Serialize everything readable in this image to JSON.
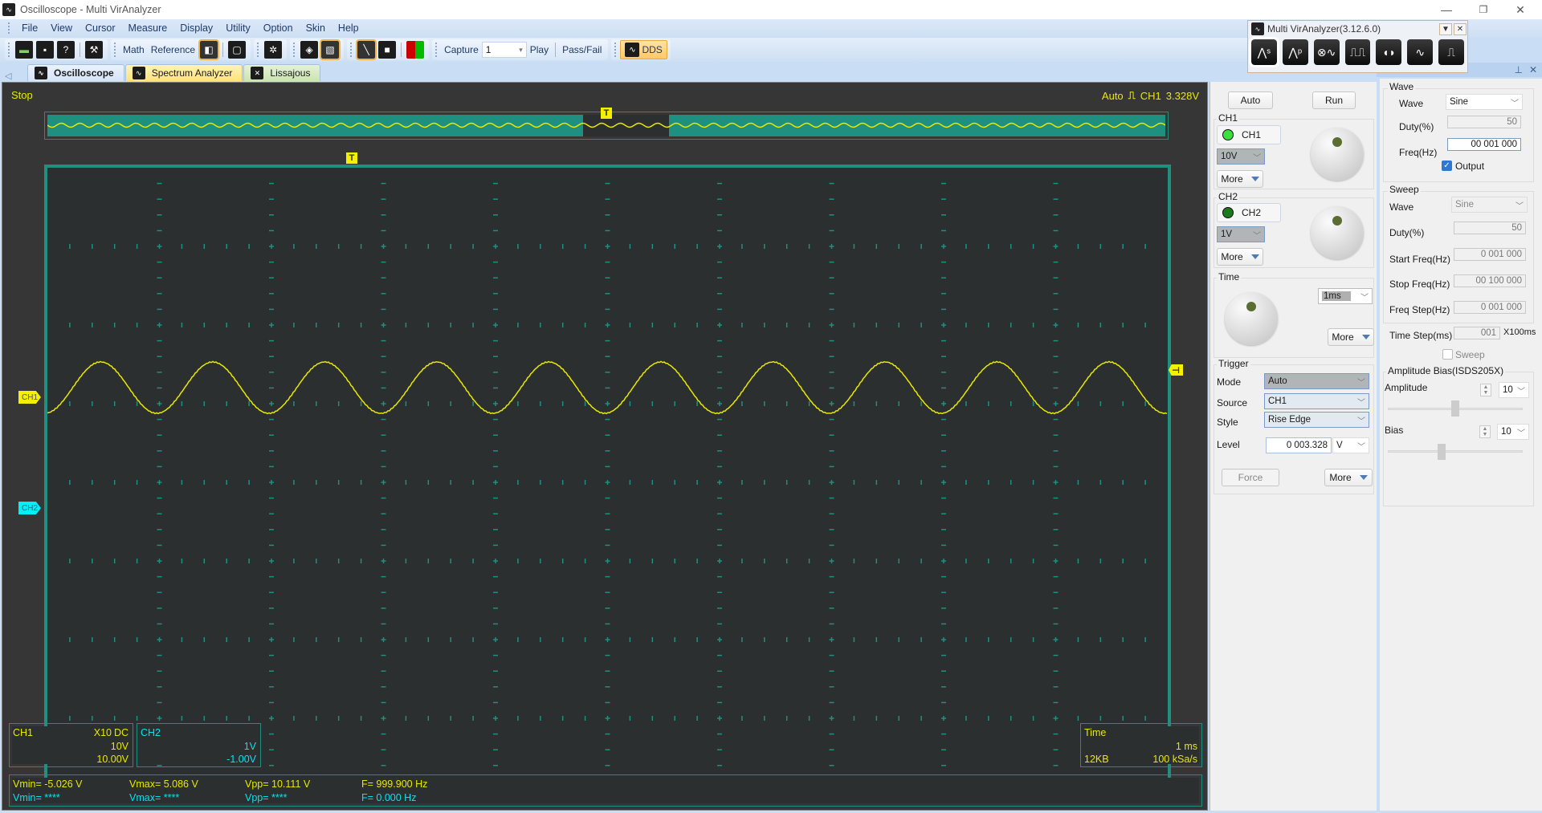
{
  "window": {
    "title": "Oscilloscope - Multi VirAnalyzer",
    "controls": {
      "minimize": "—",
      "maximize": "❐",
      "close": "✕"
    }
  },
  "menu": [
    "File",
    "View",
    "Cursor",
    "Measure",
    "Display",
    "Utility",
    "Option",
    "Skin",
    "Help"
  ],
  "toolbar": {
    "math_label": "Math",
    "reference_label": "Reference",
    "capture_label": "Capture",
    "capture_value": "1",
    "play_label": "Play",
    "passfail_label": "Pass/Fail",
    "dds_label": "DDS"
  },
  "tabs": [
    {
      "label": "Oscilloscope",
      "active": true
    },
    {
      "label": "Spectrum Analyzer",
      "active": false
    },
    {
      "label": "Lissajous",
      "active": false
    }
  ],
  "scope": {
    "run_state": "Stop",
    "trigger_mode": "Auto",
    "trigger_channel": "CH1",
    "trigger_level": "3.328V",
    "ch1_tag": "CH1",
    "ch2_tag": "CH2",
    "trigger_marker": "T",
    "colors": {
      "ch1": "#e8e800",
      "ch2": "#00e5f0",
      "grid": "#1f9080",
      "background": "#2b2f2f"
    },
    "signal": {
      "ch1_vmin_v": -5.026,
      "ch1_vmax_v": 5.086,
      "frequency_hz": 999.9,
      "time_per_div_ms": 1,
      "cycles_visible": 10
    },
    "ch1_info": {
      "name": "CH1",
      "probe": "X10",
      "coupling": "DC",
      "volts_div": "10V",
      "offset": "10.00V"
    },
    "ch2_info": {
      "name": "CH2",
      "volts_div": "1V",
      "offset": "-1.00V"
    },
    "time_info": {
      "name": "Time",
      "time_div": "1 ms",
      "memory": "12KB",
      "sample_rate": "100 kSa/s"
    },
    "measurements": {
      "ch1": {
        "vmin": "Vmin= -5.026 V",
        "vmax": "Vmax= 5.086 V",
        "vpp": "Vpp= 10.111 V",
        "freq": "F= 999.900 Hz"
      },
      "ch2": {
        "vmin": "Vmin= ****",
        "vmax": "Vmax= ****",
        "vpp": "Vpp= ****",
        "freq": "F= 0.000 Hz"
      }
    }
  },
  "controls": {
    "auto_label": "Auto",
    "run_label": "Run",
    "ch1": {
      "group": "CH1",
      "button": "CH1",
      "volts": "10V",
      "more": "More"
    },
    "ch2": {
      "group": "CH2",
      "button": "CH2",
      "volts": "1V",
      "more": "More"
    },
    "time": {
      "group": "Time",
      "value": "1ms",
      "more": "More"
    },
    "trigger": {
      "group": "Trigger",
      "mode_label": "Mode",
      "mode": "Auto",
      "source_label": "Source",
      "source": "CH1",
      "style_label": "Style",
      "style": "Rise Edge",
      "level_label": "Level",
      "level": "0 003.328",
      "level_unit": "V",
      "force": "Force",
      "more": "More"
    }
  },
  "float_window": {
    "title": "Multi VirAnalyzer(3.12.6.0)",
    "tools": [
      "spectrum-s",
      "spectrum-p",
      "recorder",
      "square",
      "burst",
      "arbitrary",
      "pulse"
    ]
  },
  "dds": {
    "wave_group": "Wave",
    "wave_label": "Wave",
    "wave": "Sine",
    "duty_label": "Duty(%)",
    "duty": "50",
    "freq_label": "Freq(Hz)",
    "freq": "00 001 000",
    "output_label": "Output",
    "output_checked": true,
    "sweep_group": "Sweep",
    "sweep_wave_label": "Wave",
    "sweep_wave": "Sine",
    "sweep_duty_label": "Duty(%)",
    "sweep_duty": "50",
    "start_label": "Start Freq(Hz)",
    "start": "0 001 000",
    "stop_label": "Stop Freq(Hz)",
    "stop": "00 100 000",
    "step_label": "Freq Step(Hz)",
    "step": "0 001 000",
    "timestep_label": "Time Step(ms)",
    "timestep": "001",
    "timestep_unit": "X100ms",
    "sweep_check_label": "Sweep",
    "sweep_checked": false,
    "amp_group": "Amplitude Bias(ISDS205X)",
    "amplitude_label": "Amplitude",
    "amplitude": "10",
    "amplitude_slider_fraction": 0.5,
    "bias_label": "Bias",
    "bias": "10",
    "bias_slider_fraction": 0.4
  }
}
